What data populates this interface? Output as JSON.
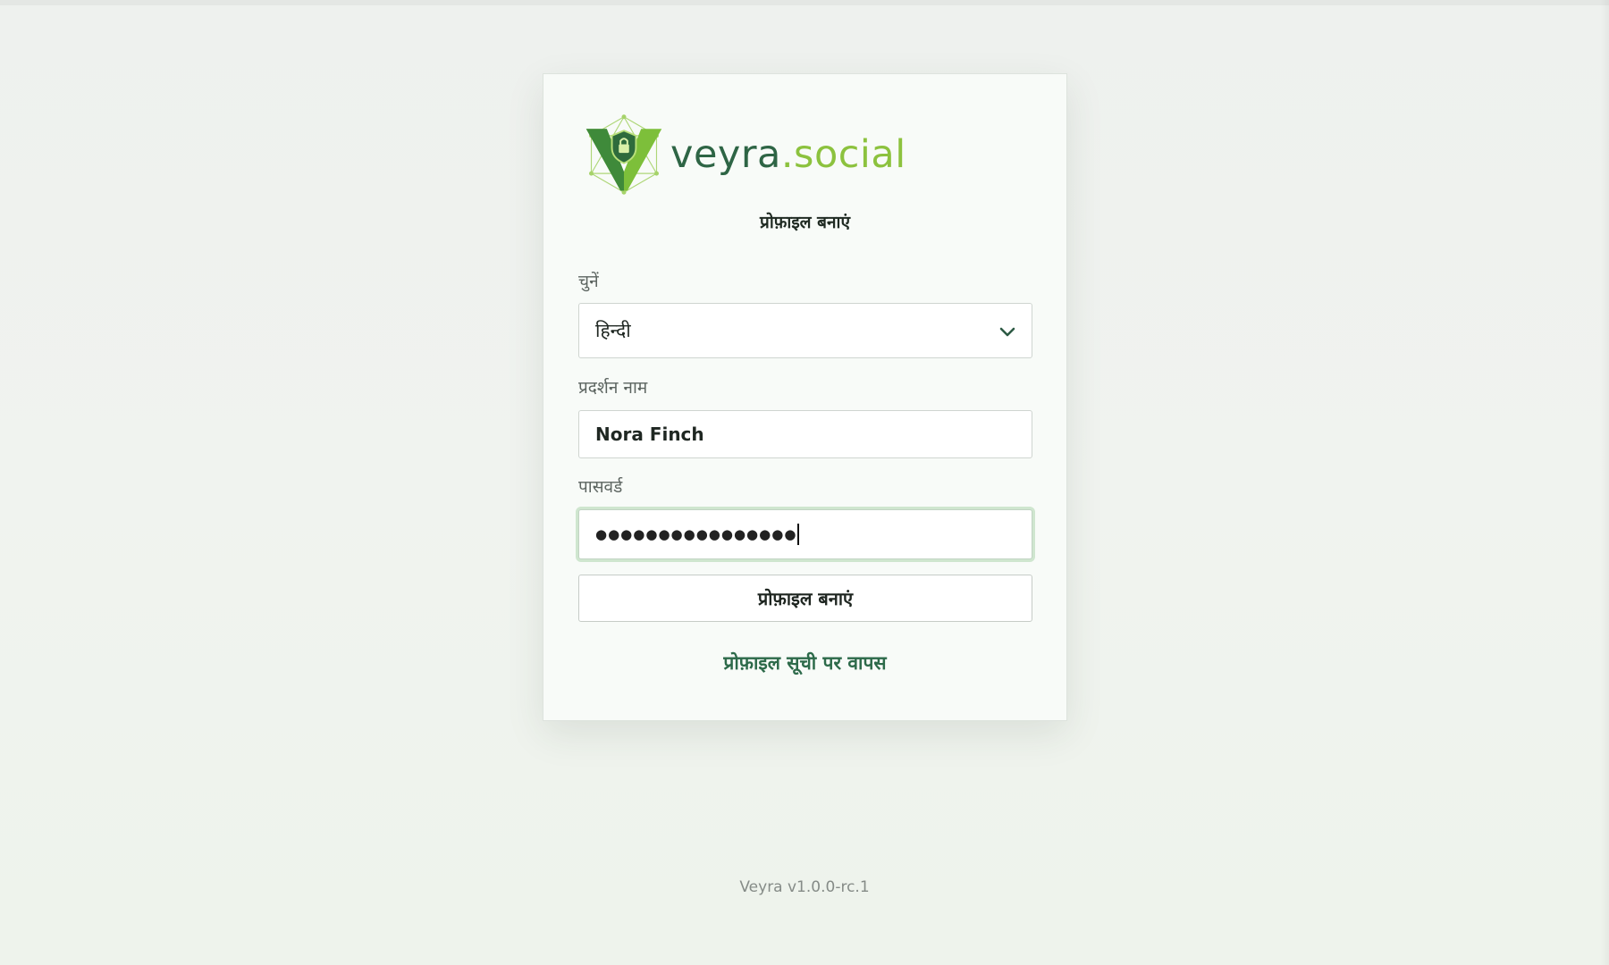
{
  "brand": {
    "logo_icon": "veyra-shield-v-icon",
    "name_part1": "veyra",
    "name_part2": ".social",
    "colors": {
      "dark": "#2e6545",
      "light": "#8cc23e"
    }
  },
  "form": {
    "title": "प्रोफ़ाइल बनाएं",
    "language_label": "चुनें",
    "language_value": "हिन्दी",
    "display_name_label": "प्रदर्शन नाम",
    "display_name_value": "Nora Finch",
    "password_label": "पासवर्ड",
    "password_value_masked": "●●●●●●●●●●●●●●●●",
    "submit_label": "प्रोफ़ाइल बनाएं",
    "back_link": "प्रोफ़ाइल सूची पर वापस"
  },
  "footer": {
    "version": "Veyra v1.0.0-rc.1"
  },
  "colors": {
    "link": "#2d6a4a",
    "focus_ring": "#cfe6cf"
  }
}
